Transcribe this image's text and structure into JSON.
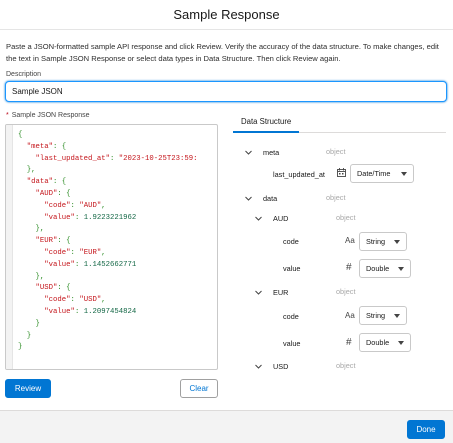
{
  "modal": {
    "title": "Sample Response"
  },
  "intro": {
    "text": "Paste a JSON-formatted sample API response and click Review. Verify the accuracy of the data structure. To make changes, edit the text in Sample JSON Response or select data types in Data Structure. Then click Review again."
  },
  "description": {
    "label": "Description",
    "value": "Sample JSON"
  },
  "json_response": {
    "required_marker": "*",
    "label": "Sample JSON Response",
    "lines": [
      [
        {
          "t": "{",
          "c": "p"
        }
      ],
      [
        {
          "t": "  \"meta\"",
          "c": "k"
        },
        {
          "t": ": {",
          "c": "p"
        }
      ],
      [
        {
          "t": "    \"last_updated_at\"",
          "c": "k"
        },
        {
          "t": ": ",
          "c": "p"
        },
        {
          "t": "\"2023-10-25T23:59:",
          "c": "s"
        }
      ],
      [
        {
          "t": "  },",
          "c": "p"
        }
      ],
      [
        {
          "t": "  \"data\"",
          "c": "k"
        },
        {
          "t": ": {",
          "c": "p"
        }
      ],
      [
        {
          "t": "    \"AUD\"",
          "c": "k"
        },
        {
          "t": ": {",
          "c": "p"
        }
      ],
      [
        {
          "t": "      \"code\"",
          "c": "k"
        },
        {
          "t": ": ",
          "c": "p"
        },
        {
          "t": "\"AUD\"",
          "c": "s"
        },
        {
          "t": ",",
          "c": "p"
        }
      ],
      [
        {
          "t": "      \"value\"",
          "c": "k"
        },
        {
          "t": ": ",
          "c": "p"
        },
        {
          "t": "1.9223221962",
          "c": "n"
        }
      ],
      [
        {
          "t": "    },",
          "c": "p"
        }
      ],
      [
        {
          "t": "    \"EUR\"",
          "c": "k"
        },
        {
          "t": ": {",
          "c": "p"
        }
      ],
      [
        {
          "t": "      \"code\"",
          "c": "k"
        },
        {
          "t": ": ",
          "c": "p"
        },
        {
          "t": "\"EUR\"",
          "c": "s"
        },
        {
          "t": ",",
          "c": "p"
        }
      ],
      [
        {
          "t": "      \"value\"",
          "c": "k"
        },
        {
          "t": ": ",
          "c": "p"
        },
        {
          "t": "1.1452662771",
          "c": "n"
        }
      ],
      [
        {
          "t": "    },",
          "c": "p"
        }
      ],
      [
        {
          "t": "    \"USD\"",
          "c": "k"
        },
        {
          "t": ": {",
          "c": "p"
        }
      ],
      [
        {
          "t": "      \"code\"",
          "c": "k"
        },
        {
          "t": ": ",
          "c": "p"
        },
        {
          "t": "\"USD\"",
          "c": "s"
        },
        {
          "t": ",",
          "c": "p"
        }
      ],
      [
        {
          "t": "      \"value\"",
          "c": "k"
        },
        {
          "t": ": ",
          "c": "p"
        },
        {
          "t": "1.2097454824",
          "c": "n"
        }
      ],
      [
        {
          "t": "    }",
          "c": "p"
        }
      ],
      [
        {
          "t": "  }",
          "c": "p"
        }
      ],
      [
        {
          "t": "}",
          "c": "p"
        }
      ]
    ]
  },
  "buttons": {
    "review": "Review",
    "clear": "Clear",
    "done": "Done"
  },
  "data_structure": {
    "tab_label": "Data Structure",
    "meta": {
      "name": "meta",
      "type": "object"
    },
    "last_updated_at": {
      "name": "last_updated_at",
      "icon": "calendar-icon",
      "selected": "Date/Time"
    },
    "data": {
      "name": "data",
      "type": "object"
    },
    "aud": {
      "name": "AUD",
      "type": "object"
    },
    "aud_code": {
      "name": "code",
      "icon_text": "Aa",
      "selected": "String"
    },
    "aud_value": {
      "name": "value",
      "icon_text": "#",
      "selected": "Double"
    },
    "eur": {
      "name": "EUR",
      "type": "object"
    },
    "eur_code": {
      "name": "code",
      "icon_text": "Aa",
      "selected": "String"
    },
    "eur_value": {
      "name": "value",
      "icon_text": "#",
      "selected": "Double"
    },
    "usd": {
      "name": "USD",
      "type": "object"
    }
  },
  "colors": {
    "brand": "#0176d3",
    "required": "#ba0517",
    "json_key": "#c4141a",
    "json_number": "#116644",
    "json_punct": "#2a8b22"
  }
}
